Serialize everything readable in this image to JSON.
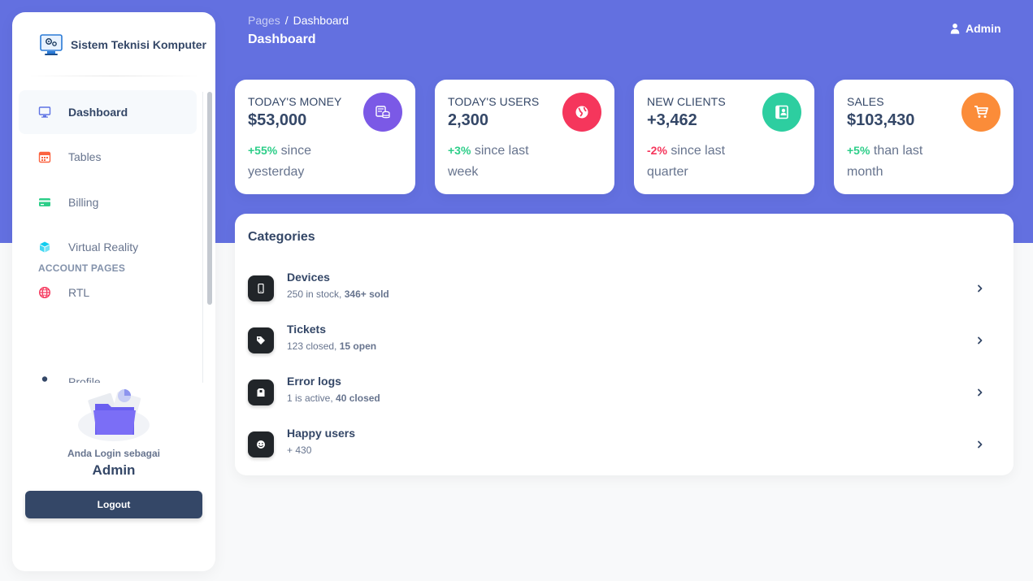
{
  "app": {
    "name": "Sistem Teknisi Komputer"
  },
  "header": {
    "breadcrumb_parent": "Pages",
    "breadcrumb_current": "Dashboard",
    "title": "Dashboard",
    "user_label": "Admin"
  },
  "sidebar": {
    "items": [
      {
        "label": "Dashboard",
        "icon": "monitor-icon",
        "active": true
      },
      {
        "label": "Tables",
        "icon": "calendar-icon"
      },
      {
        "label": "Billing",
        "icon": "credit-card-icon"
      },
      {
        "label": "Virtual Reality",
        "icon": "cube-icon"
      },
      {
        "label": "RTL",
        "icon": "globe-icon"
      }
    ],
    "section_label": "ACCOUNT PAGES",
    "account_items": [
      {
        "label": "Profile",
        "icon": "user-icon"
      }
    ],
    "user_card": {
      "login_as": "Anda Login sebagai",
      "name": "Admin",
      "logout_label": "Logout"
    }
  },
  "stats": [
    {
      "label": "TODAY'S MONEY",
      "value": "$53,000",
      "change": "+55%",
      "note": "since yesterday",
      "trend": "up",
      "color": "#7b59e6",
      "icon": "database-icon"
    },
    {
      "label": "TODAY'S USERS",
      "value": "2,300",
      "change": "+3%",
      "note": "since last week",
      "trend": "up",
      "color": "#f5365c",
      "icon": "globe-icon"
    },
    {
      "label": "NEW CLIENTS",
      "value": "+3,462",
      "change": "-2%",
      "note": "since last quarter",
      "trend": "down",
      "color": "#2dcea0",
      "icon": "contact-card-icon"
    },
    {
      "label": "SALES",
      "value": "$103,430",
      "change": "+5%",
      "note": "than last month",
      "trend": "up",
      "color": "#fb8c39",
      "icon": "cart-icon"
    }
  ],
  "categories": {
    "title": "Categories",
    "items": [
      {
        "name": "Devices",
        "detail": "250 in stock,",
        "detail_bold": "346+ sold",
        "icon": "mobile-icon"
      },
      {
        "name": "Tickets",
        "detail": "123 closed,",
        "detail_bold": "15 open",
        "icon": "tag-icon"
      },
      {
        "name": "Error logs",
        "detail": "1 is active,",
        "detail_bold": "40 closed",
        "icon": "box-icon"
      },
      {
        "name": "Happy users",
        "detail": "+ 430",
        "detail_bold": "",
        "icon": "smile-icon"
      }
    ]
  },
  "colors": {
    "header_bg": "#6370e0",
    "text_dark": "#344767",
    "text_muted": "#67748e",
    "positive": "#2dce89",
    "negative": "#f5365c"
  }
}
